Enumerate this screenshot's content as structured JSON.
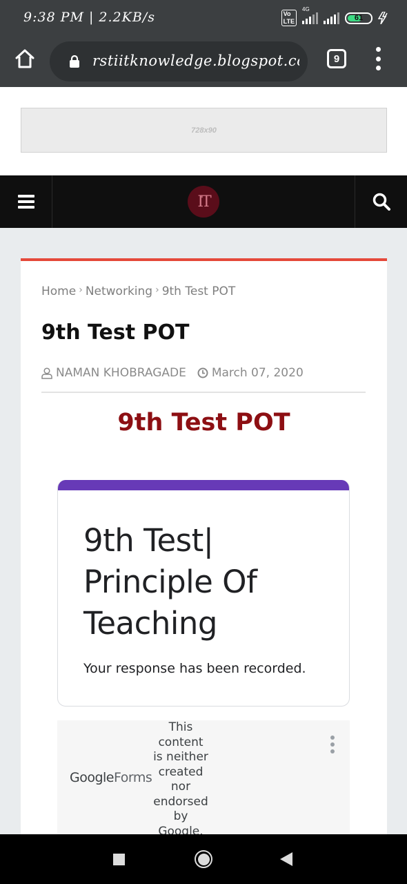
{
  "status_bar": {
    "time": "9:38 PM | 2.2KB/s",
    "volte_label": "Vo LTE",
    "network_label": "4G",
    "battery_level": "61"
  },
  "browser": {
    "url": "rstiitknowledge.blogspot.com",
    "tab_count": "9"
  },
  "ad": {
    "label": "728x90"
  },
  "site_nav": {
    "logo_text": "IT"
  },
  "breadcrumb": {
    "items": [
      "Home",
      "Networking",
      "9th Test POT"
    ],
    "separator": "›"
  },
  "post": {
    "title": "9th Test POT",
    "author": "NAMAN KHOBRAGADE",
    "date": "March 07, 2020",
    "heading": "9th Test POT",
    "heading_color": "#8d0f13"
  },
  "google_form": {
    "title": "9th Test| Principle Of Teaching",
    "response_message": "Your response has been recorded.",
    "accent_color": "#673ab7",
    "logo_google": "Google",
    "logo_forms": "Forms",
    "disclaimer": "This content is neither created nor endorsed by Google."
  },
  "colors": {
    "card_top_border": "#e5493a",
    "nav_background": "#0f0f0f"
  }
}
